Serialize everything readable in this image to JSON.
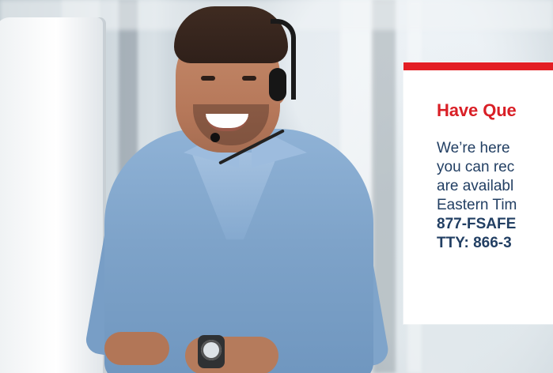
{
  "panel": {
    "title": "Have Que",
    "lines": [
      "We’re here",
      "you can rec",
      "are availabl",
      "Eastern Tim",
      "877-FSAFE",
      "TTY: 866-3"
    ]
  },
  "colors": {
    "accent_red": "#e31e24",
    "title_red": "#d91f26",
    "text_navy": "#223f63",
    "panel_bg": "#ffffff"
  }
}
